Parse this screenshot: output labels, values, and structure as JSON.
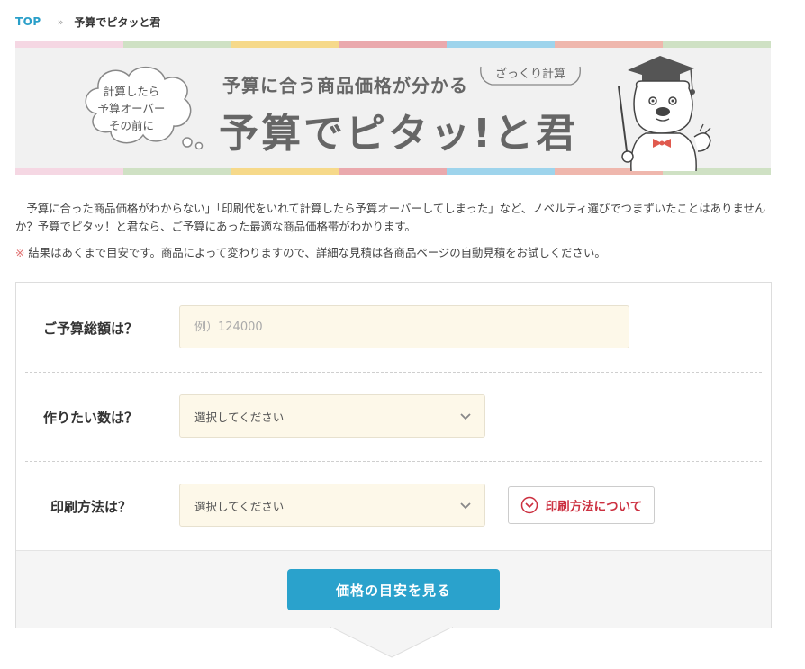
{
  "breadcrumb": {
    "home": "TOP",
    "separator": "»",
    "current": "予算でピタッと君"
  },
  "banner": {
    "cloud_lines": [
      "計算したら",
      "予算オーバー",
      "その前に"
    ],
    "subtitle": "予算に合う商品価格が分かる",
    "tag": "ざっくり計算",
    "title": "予算でピタッ!と君",
    "stripe_colors": [
      "#f5d7e3",
      "#cfe1c4",
      "#f6d98a",
      "#eaa9ad",
      "#9ed4ec",
      "#efb7ad",
      "#cfe1c4"
    ]
  },
  "intro": {
    "text": "「予算に合った商品価格がわからない」「印刷代をいれて計算したら予算オーバーしてしまった」など、ノベルティ選びでつまずいたことはありませんか？予算でピタッ！と君なら、ご予算にあった最適な商品価格帯がわかります。",
    "note_mark": "※",
    "note": "結果はあくまで目安です。商品によって変わりますので、詳細な見積は各商品ページの自動見積をお試しください。"
  },
  "form": {
    "budget_label": "ご予算総額は？",
    "budget_placeholder": "例）124000",
    "quantity_label": "作りたい数は？",
    "quantity_value": "選択してください",
    "print_label": "印刷方法は？",
    "print_value": "選択してください",
    "print_about": "印刷方法について",
    "submit": "価格の目安を見る"
  },
  "colors": {
    "accent": "#2aa2cc",
    "link": "#2a9fc9",
    "warning": "#cc3040",
    "field_bg": "#fdf8e9"
  }
}
